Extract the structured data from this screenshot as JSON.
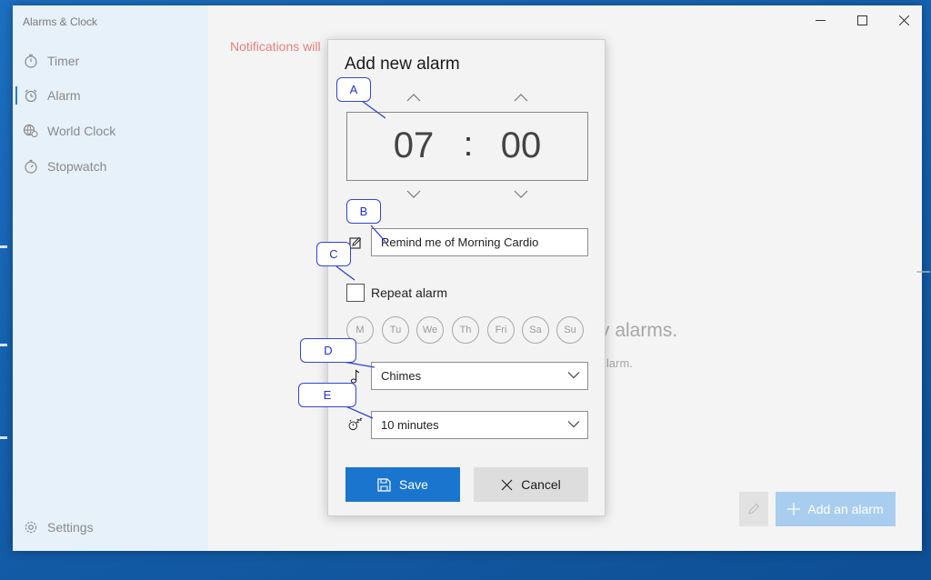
{
  "app": {
    "title": "Alarms & Clock"
  },
  "nav": {
    "items": [
      {
        "label": "Timer",
        "icon": "timer-icon"
      },
      {
        "label": "Alarm",
        "icon": "alarm-clock-icon"
      },
      {
        "label": "World Clock",
        "icon": "globe-icon"
      },
      {
        "label": "Stopwatch",
        "icon": "stopwatch-icon"
      }
    ],
    "active_index": 1,
    "settings_label": "Settings"
  },
  "background": {
    "notification_text": "Notifications will",
    "empty_title": "y alarms.",
    "empty_sub": "larm.",
    "add_alarm_label": "Add an alarm"
  },
  "dialog": {
    "title": "Add new alarm",
    "hour": "07",
    "separator": ":",
    "minute": "00",
    "name_value": "Remind me of Morning Cardio",
    "repeat_label": "Repeat alarm",
    "repeat_checked": false,
    "days": [
      "M",
      "Tu",
      "We",
      "Th",
      "Fri",
      "Sa",
      "Su"
    ],
    "sound_value": "Chimes",
    "snooze_value": "10 minutes",
    "save_label": "Save",
    "cancel_label": "Cancel"
  },
  "annotations": [
    "A",
    "B",
    "C",
    "D",
    "E"
  ],
  "colors": {
    "accent": "#1a75cf",
    "add_button": "#a9cdee",
    "nav_bg": "#e6f1fa",
    "notification": "#e8807a",
    "callout": "#3344d6"
  }
}
